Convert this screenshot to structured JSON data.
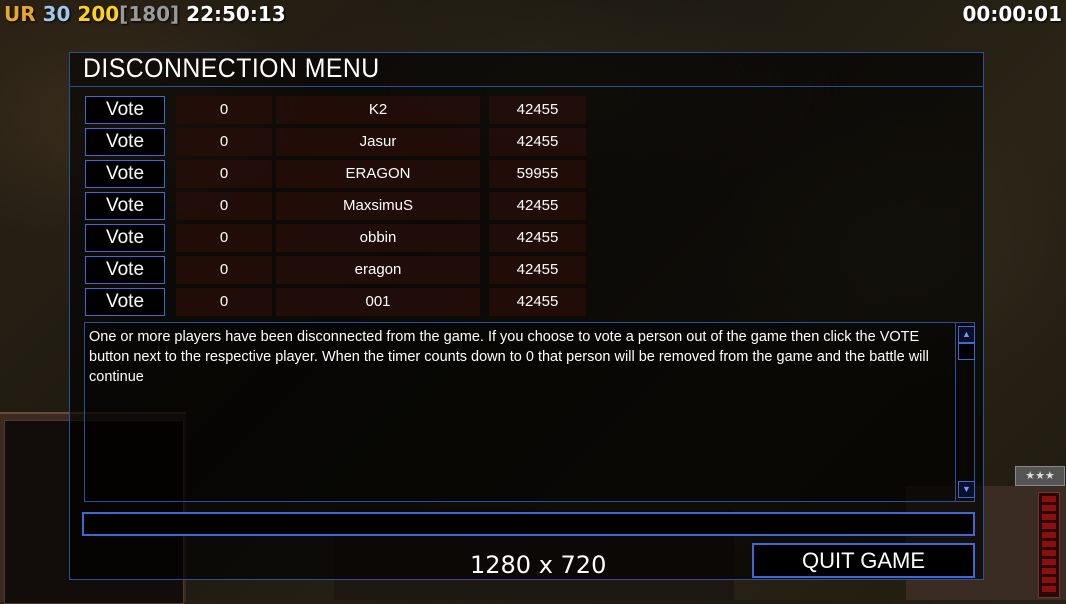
{
  "hud": {
    "rank": "UR",
    "level": "30",
    "money": "200",
    "money_cap": "[180]",
    "clock": "22:50:13",
    "timer": "00:00:01"
  },
  "dialog": {
    "title": "DISCONNECTION MENU",
    "vote_label": "Vote",
    "players": [
      {
        "votes": "0",
        "name": "K2",
        "value": "42455"
      },
      {
        "votes": "0",
        "name": "Jasur",
        "value": "42455"
      },
      {
        "votes": "0",
        "name": "ERAGON",
        "value": "59955"
      },
      {
        "votes": "0",
        "name": "MaxsimuS",
        "value": "42455"
      },
      {
        "votes": "0",
        "name": "obbin",
        "value": "42455"
      },
      {
        "votes": "0",
        "name": "eragon",
        "value": "42455"
      },
      {
        "votes": "0",
        "name": "001",
        "value": "42455"
      }
    ],
    "message": "One or more players have been disconnected from the game. If you choose to vote a person out of the game then click the VOTE button next to the respective player. When the timer counts down to 0 that person will be removed from the game and the battle will continue",
    "chat_value": "",
    "resolution": "1280 x 720",
    "quit_label": "QUIT GAME"
  },
  "colors": {
    "border": "#2d4f9a",
    "button_border": "#3d6ad0",
    "rank": "#e8a630",
    "level": "#9fc8f0",
    "money": "#ffd21e"
  },
  "icons": {
    "scroll_up": "arrow-up-icon",
    "scroll_down": "arrow-down-icon"
  }
}
